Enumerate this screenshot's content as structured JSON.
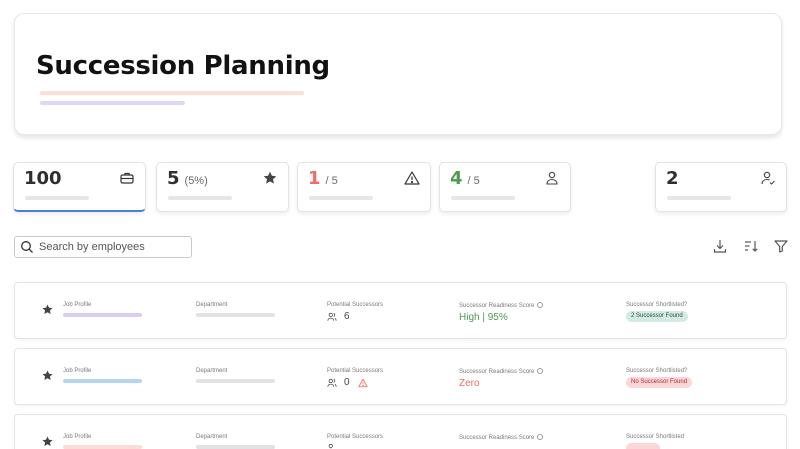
{
  "page": {
    "title": "Succession Planning"
  },
  "stats": [
    {
      "value": "100",
      "sub": "",
      "icon": "briefcase-icon"
    },
    {
      "value": "5",
      "sub": "(5%)",
      "icon": "star-icon"
    },
    {
      "value": "1",
      "sub": "/ 5",
      "icon": "warning-icon",
      "color": "#f26b6b"
    },
    {
      "value": "4",
      "sub": "/ 5",
      "icon": "person-icon",
      "color": "#4f9a50"
    },
    {
      "value": "2",
      "sub": "",
      "icon": "person-check-icon"
    }
  ],
  "search": {
    "placeholder": "Search by employees"
  },
  "toolbar": {
    "icons": [
      "download-icon",
      "sort-icon",
      "filter-icon"
    ]
  },
  "columns": {
    "job_profile": "Job Profile",
    "department": "Department",
    "potential_successors": "Potential Successors",
    "readiness_score": "Successor Readiness Score",
    "shortlisted": "Successor Shortlisted?",
    "shortlisted_alt": "Successor Shortlisted"
  },
  "rows": [
    {
      "successors": "6",
      "score": "High  |  95%",
      "badge": "2 Successor Found",
      "profile_bar_color": "#d4cff4"
    },
    {
      "successors": "0",
      "score": "Zero",
      "badge": "No Successor Found",
      "profile_bar_color": "#b4d6f4"
    },
    {
      "successors": "",
      "score": "",
      "badge": "",
      "profile_bar_color": "#fcdcd3"
    }
  ],
  "colors": {
    "accent": "#4a7fd6",
    "danger": "#f26b6b",
    "success": "#4f9a50"
  }
}
